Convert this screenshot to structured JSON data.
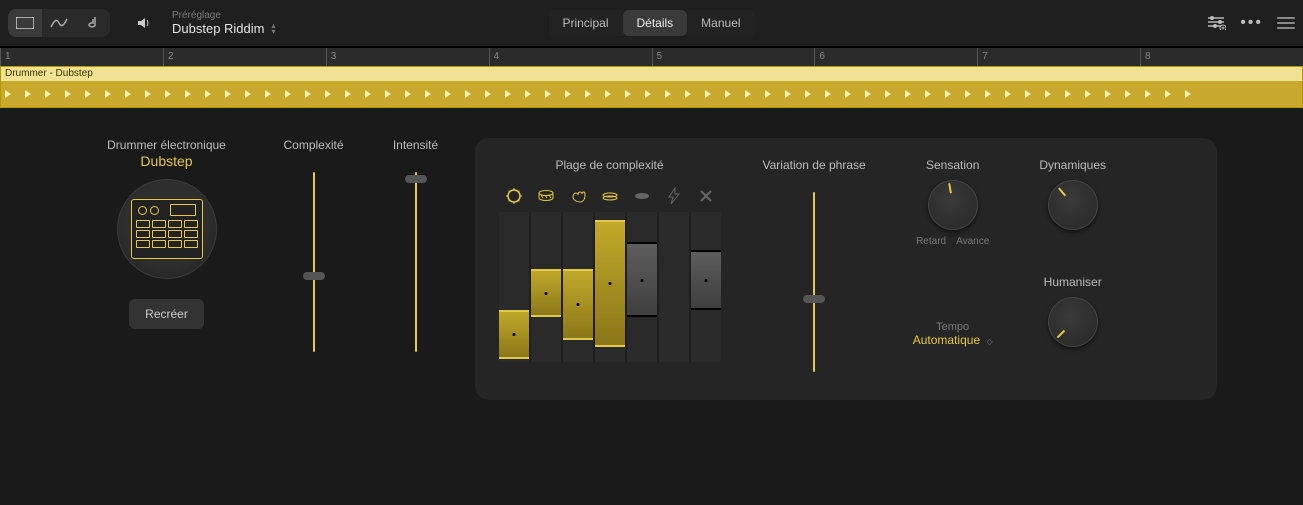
{
  "header": {
    "preset_label": "Préréglage",
    "preset_value": "Dubstep Riddim",
    "tabs": [
      "Principal",
      "Détails",
      "Manuel"
    ],
    "selected_tab": 1
  },
  "ruler": {
    "marks": [
      "1",
      "2",
      "3",
      "4",
      "5",
      "6",
      "7",
      "8"
    ]
  },
  "region": {
    "name": "Drummer - Dubstep"
  },
  "drummer": {
    "label": "Drummer électronique",
    "style": "Dubstep",
    "recreate_label": "Recréer"
  },
  "sliders": {
    "complexity": {
      "label": "Complexité",
      "value": 0.58
    },
    "intensity": {
      "label": "Intensité",
      "value": 0.02
    },
    "phrase": {
      "label": "Variation de phrase",
      "value": 0.6
    }
  },
  "complexity_range": {
    "label": "Plage de complexité",
    "instruments": [
      "crash-cymbal",
      "snare-drum",
      "clap",
      "hi-hat",
      "bass",
      "lightning",
      "cross"
    ],
    "bars": [
      {
        "active": true,
        "low": 0.02,
        "high": 0.35
      },
      {
        "active": true,
        "low": 0.3,
        "high": 0.62
      },
      {
        "active": true,
        "low": 0.15,
        "high": 0.62
      },
      {
        "active": true,
        "low": 0.1,
        "high": 0.95
      },
      {
        "active": false,
        "low": 0.3,
        "high": 0.8
      },
      {
        "active": false,
        "low": 0.0,
        "high": 0.0
      },
      {
        "active": false,
        "low": 0.35,
        "high": 0.75
      }
    ]
  },
  "knobs": {
    "feel": {
      "label": "Sensation",
      "sub": [
        "Retard",
        "Avance"
      ],
      "angle": -10
    },
    "dynamics": {
      "label": "Dynamiques",
      "angle": -40
    },
    "humanize": {
      "label": "Humaniser",
      "angle": -135
    }
  },
  "tempo": {
    "label": "Tempo",
    "value": "Automatique"
  }
}
